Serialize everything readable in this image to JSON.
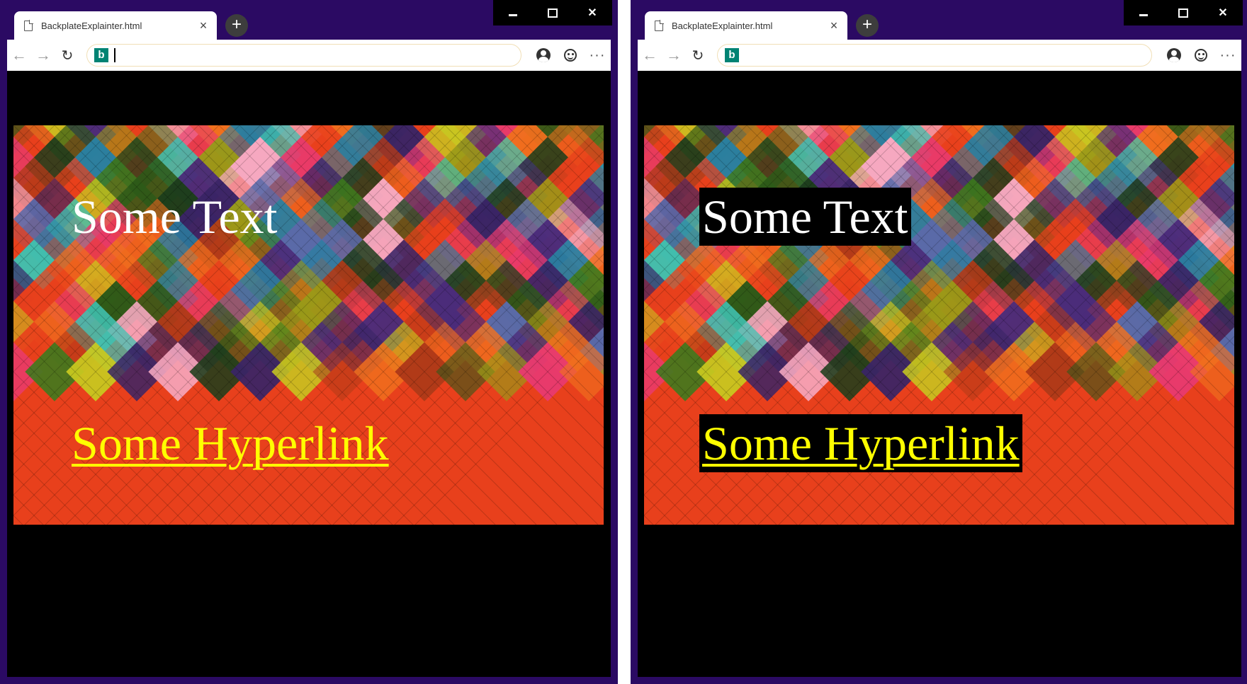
{
  "colors": {
    "window_frame": "#2b0a63",
    "page_background": "#000000",
    "text_color": "#ffffff",
    "link_color": "#ffff00",
    "backplate_color": "#000000",
    "bing_brand": "#008373"
  },
  "windows": [
    {
      "id": "without-backplate",
      "tab": {
        "title": "BackplateExplainter.html",
        "close_glyph": "×"
      },
      "new_tab_glyph": "+",
      "controls": {
        "close_glyph": "✕"
      },
      "toolbar": {
        "back_glyph": "←",
        "forward_glyph": "→",
        "refresh_glyph": "↻",
        "more_glyph": "···",
        "search_engine_icon": "b",
        "address_value": ""
      },
      "content": {
        "text": "Some Text",
        "link": "Some Hyperlink",
        "backplate": false
      }
    },
    {
      "id": "with-backplate",
      "tab": {
        "title": "BackplateExplainter.html",
        "close_glyph": "×"
      },
      "new_tab_glyph": "+",
      "controls": {
        "close_glyph": "✕"
      },
      "toolbar": {
        "back_glyph": "←",
        "forward_glyph": "→",
        "refresh_glyph": "↻",
        "more_glyph": "···",
        "search_engine_icon": "b",
        "address_value": ""
      },
      "content": {
        "text": "Some Text",
        "link": "Some Hyperlink",
        "backplate": true
      }
    }
  ],
  "pattern_palette": [
    "#e8401c",
    "#f0701e",
    "#3f7a1e",
    "#2d5a18",
    "#4b2c7a",
    "#3a2466",
    "#2a7fa0",
    "#40c0b0",
    "#f6a8c0",
    "#e83a6e",
    "#c8c820",
    "#9a9a18",
    "#5a6aa8",
    "#1e3e1c",
    "#b03a18"
  ]
}
